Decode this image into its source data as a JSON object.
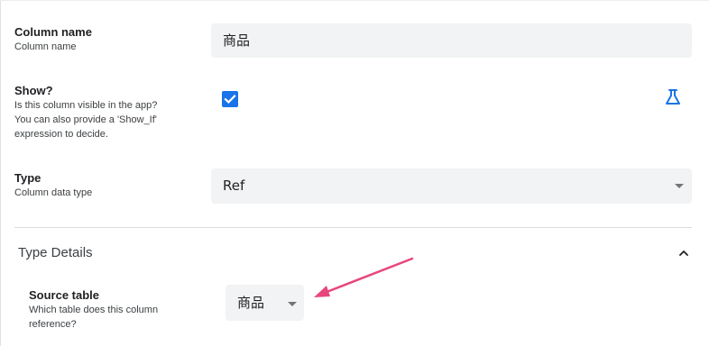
{
  "fields": {
    "column_name": {
      "title": "Column name",
      "description": "Column name",
      "value": "商品"
    },
    "show": {
      "title": "Show?",
      "description_line1": "Is this column visible in the app?",
      "description_line2": "You can also provide a 'Show_If'",
      "description_line3": "expression to decide.",
      "checked": true
    },
    "type": {
      "title": "Type",
      "description": "Column data type",
      "value": "Ref"
    }
  },
  "type_details": {
    "section_title": "Type Details",
    "source_table": {
      "title": "Source table",
      "description_line1": "Which table does this column",
      "description_line2": "reference?",
      "value": "商品"
    }
  },
  "icons": {
    "checkbox": "checkbox-checked-icon",
    "expression": "beaker-icon",
    "collapse": "chevron-up-icon",
    "dropdown": "caret-down-icon",
    "annotation": "arrow-annotation"
  },
  "colors": {
    "accent": "#1a73e8",
    "annotation_arrow": "#e8467c",
    "field_bg": "#f1f3f4"
  }
}
